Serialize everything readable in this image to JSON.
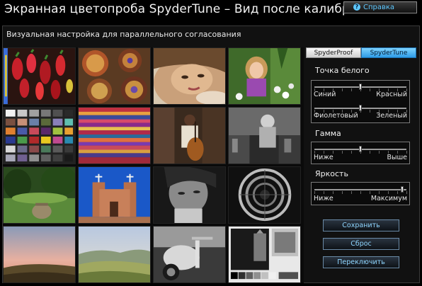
{
  "app": {
    "title": "Экранная цветопроба SpyderTune – Вид после калибровки",
    "help_label": "Справка",
    "help_icon": "question-icon"
  },
  "main": {
    "subtitle": "Визуальная настройка для параллельного согласования"
  },
  "tabs": [
    {
      "label": "SpyderProof",
      "active": false
    },
    {
      "label": "SpyderTune",
      "active": true
    }
  ],
  "white_point": {
    "label": "Точка белого",
    "rows": [
      {
        "left": "Синий",
        "right": "Красный",
        "value": 0.5
      },
      {
        "left": "Фиолетовый",
        "right": "Зеленый",
        "value": 0.5
      }
    ]
  },
  "gamma": {
    "label": "Гамма",
    "left": "Ниже",
    "right": "Выше",
    "value": 0.5
  },
  "brightness": {
    "label": "Яркость",
    "left": "Ниже",
    "right": "Максимум",
    "value": 0.95
  },
  "buttons": {
    "save": "Сохранить",
    "reset": "Сброс",
    "toggle": "Переключить"
  },
  "images": [
    "peppers-image",
    "clay-bowls-image",
    "woman-portrait-image",
    "girl-flowers-image",
    "color-chart-image",
    "woven-textiles-image",
    "cellist-image",
    "cafe-street-image",
    "garden-urn-image",
    "adobe-church-image",
    "bw-portrait-image",
    "spiral-staircase-image",
    "sunset-sky-image",
    "tuscan-hills-image",
    "scooter-bw-image",
    "gray-test-target-image"
  ],
  "colors": {
    "accent": "#2e9be6",
    "button_text": "#8fd6ff",
    "help_text": "#5ec8ff"
  }
}
